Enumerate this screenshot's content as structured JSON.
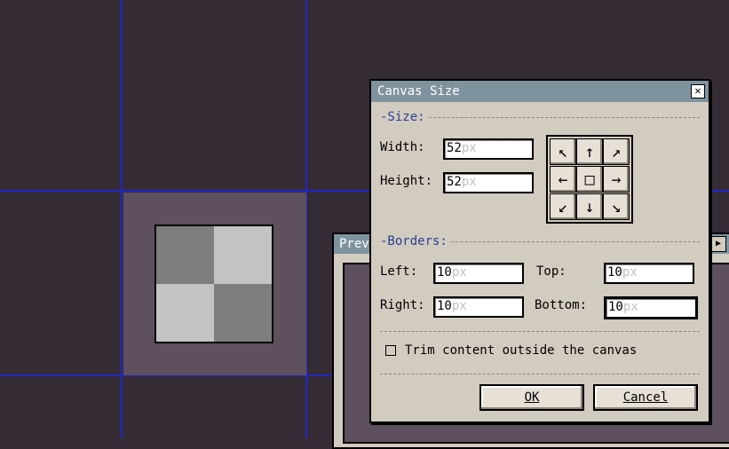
{
  "canvas": {
    "colors": {
      "background": "#352b35",
      "grid": "#1e27c8",
      "tile": "#5e505e",
      "light": "#c3c3c3",
      "dark": "#7e7e7e"
    }
  },
  "preview_window": {
    "title": "Prev",
    "nav_icon": "play-arrow-icon"
  },
  "dialog": {
    "title": "Canvas Size",
    "close_icon": "close-icon",
    "size_section": {
      "label": "-Size:",
      "width_label": "Width:",
      "width_value": "52",
      "width_unit": "px",
      "height_label": "Height:",
      "height_value": "52",
      "height_unit": "px"
    },
    "anchors": [
      "arrow-nw-icon",
      "arrow-n-icon",
      "arrow-ne-icon",
      "arrow-w-icon",
      "center-square-icon",
      "arrow-e-icon",
      "arrow-sw-icon",
      "arrow-s-icon",
      "arrow-se-icon"
    ],
    "borders_section": {
      "label": "-Borders:",
      "left_label": "Left:",
      "left_value": "10",
      "top_label": "Top:",
      "top_value": "10",
      "right_label": "Right:",
      "right_value": "10",
      "bottom_label": "Bottom:",
      "bottom_value": "10",
      "unit": "px"
    },
    "trim_checkbox": {
      "label": "Trim content outside the canvas",
      "checked": false
    },
    "ok_label": "OK",
    "cancel_label": "Cancel"
  }
}
